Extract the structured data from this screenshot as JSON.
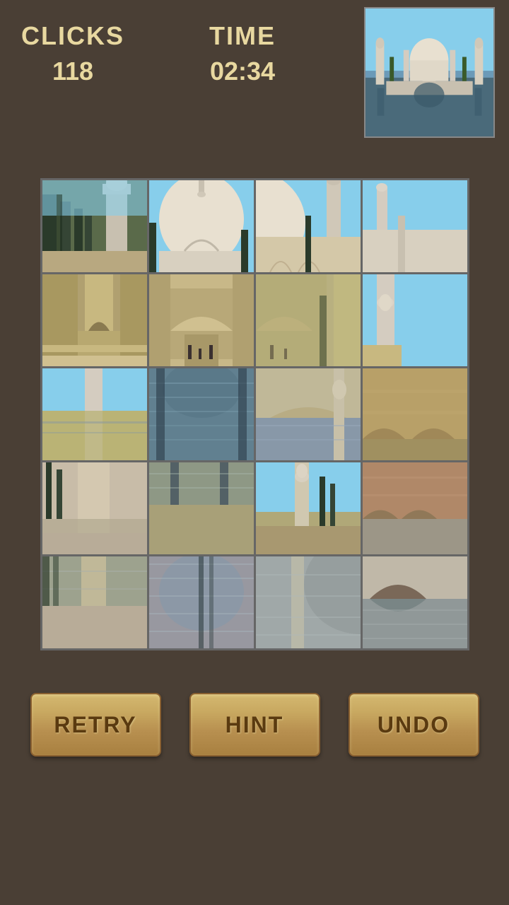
{
  "header": {
    "clicks_label": "CLICKS",
    "clicks_value": "118",
    "time_label": "TIME",
    "time_value": "02:34"
  },
  "buttons": {
    "retry_label": "RETRY",
    "hint_label": "HINT",
    "undo_label": "UNDO"
  },
  "puzzle": {
    "grid_cols": 4,
    "grid_rows": 5
  }
}
